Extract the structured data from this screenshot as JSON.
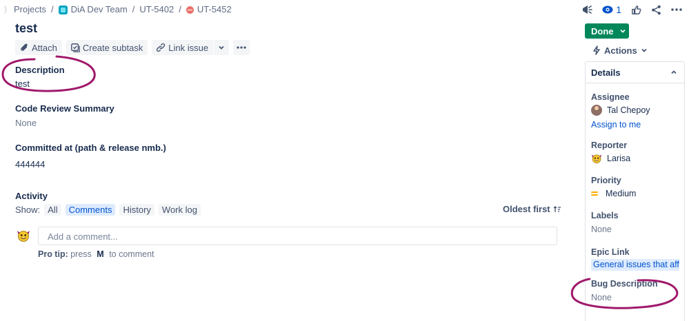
{
  "breadcrumb": {
    "edge": ")",
    "projects": "Projects",
    "sep": "/",
    "team": "DiA Dev Team",
    "parent": "UT-5402",
    "issue": "UT-5452"
  },
  "header": {
    "watchers_count": "1",
    "icons": [
      "feedback-icon",
      "eye-icon",
      "thumbs-up-icon",
      "share-icon",
      "more-icon"
    ]
  },
  "issue": {
    "title": "test"
  },
  "toolbar": {
    "attach": "Attach",
    "create_subtask": "Create subtask",
    "link_issue": "Link issue",
    "more": "•••"
  },
  "fields": {
    "description_label": "Description",
    "description_value": "test",
    "code_review_label": "Code Review Summary",
    "code_review_value": "None",
    "committed_label": "Committed at (path & release nmb.)",
    "committed_value": "444444"
  },
  "activity": {
    "heading": "Activity",
    "show_label": "Show:",
    "filters": [
      "All",
      "Comments",
      "History",
      "Work log"
    ],
    "active_filter": "Comments",
    "sort_label": "Oldest first",
    "comment_placeholder": "Add a comment...",
    "tip_label": "Pro tip:",
    "tip_press": "press",
    "tip_key": "M",
    "tip_rest": "to comment"
  },
  "sidebar": {
    "status": "Done",
    "actions": "Actions",
    "details_title": "Details",
    "assignee_label": "Assignee",
    "assignee_value": "Tal Chepoy",
    "assign_to_me": "Assign to me",
    "reporter_label": "Reporter",
    "reporter_value": "Larisa",
    "priority_label": "Priority",
    "priority_value": "Medium",
    "labels_label": "Labels",
    "labels_value": "None",
    "epic_label": "Epic Link",
    "epic_value": "General issues that aff...",
    "bug_label": "Bug Description",
    "bug_value": "None"
  },
  "colors": {
    "accent": "#0052cc",
    "done": "#00875a",
    "annotation": "#a0196b"
  }
}
